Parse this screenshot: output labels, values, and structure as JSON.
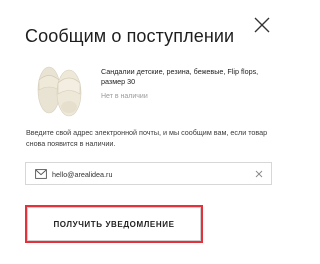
{
  "dialog": {
    "title": "Сообщим о поступлении",
    "close_icon": "close-icon"
  },
  "product": {
    "image_icon": "slides-sandals-image",
    "name": "Сандалии детские, резина, бежевые, Flip flops, размер 30",
    "status": "Нет в наличии"
  },
  "info_text": "Введите свой адрес электронной почты, и мы сообщим вам, если товар снова появится в наличии.",
  "email": {
    "icon": "mail-icon",
    "value": "hello@arealidea.ru",
    "clear_icon": "clear-icon"
  },
  "submit": {
    "label": "ПОЛУЧИТЬ УВЕДОМЛЕНИЕ"
  },
  "colors": {
    "highlight_border": "#e4323c",
    "status_text": "#9a9a9a",
    "field_border": "#d7d7d7"
  }
}
